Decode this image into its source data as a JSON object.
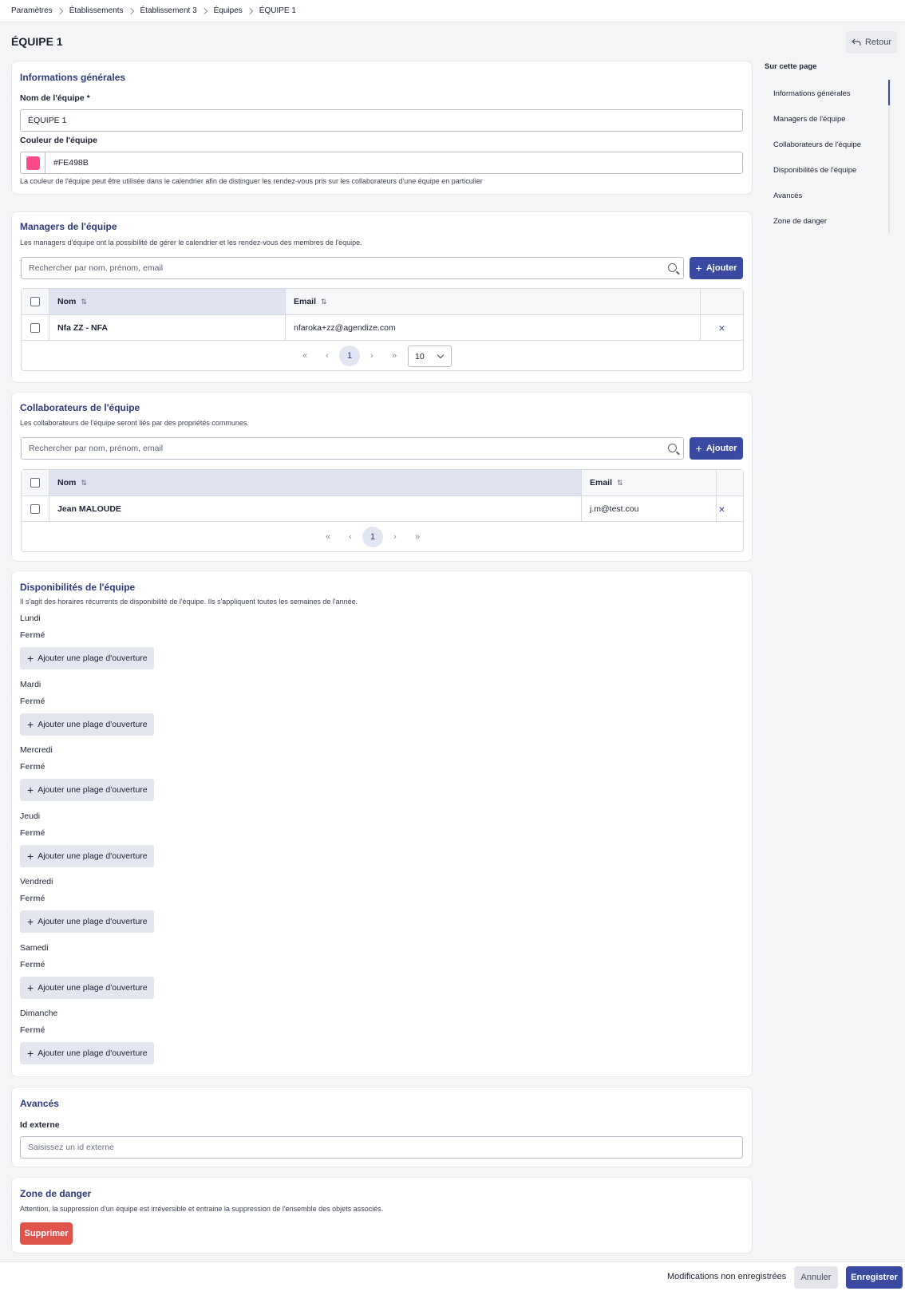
{
  "breadcrumb": [
    "Paramètres",
    "Établissements",
    "Établissement 3",
    "Équipes",
    "ÉQUIPE 1"
  ],
  "page_title": "ÉQUIPE 1",
  "back_label": "Retour",
  "general": {
    "title": "Informations générales",
    "name_label": "Nom de l'équipe *",
    "name_value": "ÉQUIPE 1",
    "color_label": "Couleur de l'équipe",
    "color_value": "#FE498B",
    "color_hint": "La couleur de l'équipe peut être utilisée dans le calendrier afin de distinguer les rendez-vous pris sur les collaborateurs d'une équipe en particulier"
  },
  "managers": {
    "title": "Managers de l'équipe",
    "desc": "Les managers d'équipe ont la possibilité de gérer le calendrier et les rendez-vous des membres de l'équipe.",
    "search_placeholder": "Rechercher par nom, prénom, email",
    "add_label": "Ajouter",
    "col_name": "Nom",
    "col_email": "Email",
    "rows": [
      {
        "name": "Nfa ZZ - NFA",
        "email": "nfaroka+zz@agendize.com"
      }
    ],
    "page": "1",
    "per_page": "10"
  },
  "collaborators": {
    "title": "Collaborateurs de l'équipe",
    "desc": "Les collaborateurs de l'équipe seront liés par des propriétés communes.",
    "search_placeholder": "Rechercher par nom, prénom, email",
    "add_label": "Ajouter",
    "col_name": "Nom",
    "col_email": "Email",
    "rows": [
      {
        "name": "Jean MALOUDE",
        "email": "j.m@test.cou"
      }
    ],
    "page": "1"
  },
  "availability": {
    "title": "Disponibilités de l'équipe",
    "desc": "Il s'agit des horaires récurrents de disponibilité de l'équipe. Ils s'appliquent toutes les semaines de l'année.",
    "closed_label": "Fermé",
    "add_slot_label": "Ajouter une plage d'ouverture",
    "days": [
      "Lundi",
      "Mardi",
      "Mercredi",
      "Jeudi",
      "Vendredi",
      "Samedi",
      "Dimanche"
    ]
  },
  "advanced": {
    "title": "Avancés",
    "external_id_label": "Id externe",
    "external_id_placeholder": "Saisissez un id externe"
  },
  "danger": {
    "title": "Zone de danger",
    "desc": "Attention, la suppression d'un équipe est irréversible et entraine la suppression de l'ensemble des objets associés.",
    "delete_label": "Supprimer"
  },
  "toc": {
    "title": "Sur cette page",
    "items": [
      "Informations générales",
      "Managers de l'équipe",
      "Collaborateurs de l'équipe",
      "Disponibilités de l'équipe",
      "Avancés",
      "Zone de danger"
    ]
  },
  "footer": {
    "unsaved": "Modifications non enregistrées",
    "cancel": "Annuler",
    "save": "Enregistrer"
  },
  "colors": {
    "primary": "#3a4aa0",
    "danger": "#e0534b",
    "team_color": "#FE498B"
  }
}
